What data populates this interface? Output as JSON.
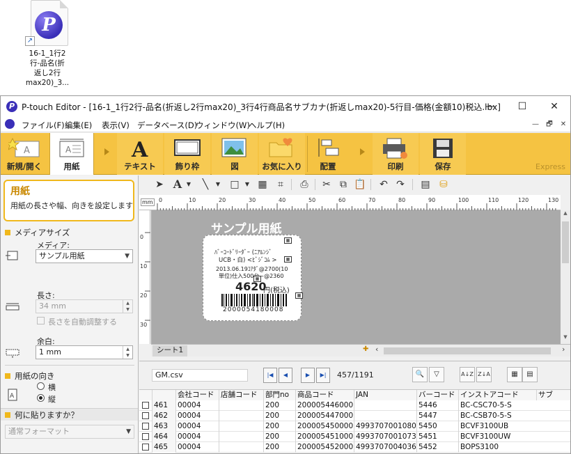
{
  "desktop_icon": {
    "label_lines": [
      "16-1_1行2",
      "行-品名(折",
      "返し2行",
      "max20)_3..."
    ]
  },
  "window": {
    "title": "P-touch Editor - [16-1_1行2行-品名(折返し2行max20)_3行4行商品名サブカナ(折返しmax20)-5行目-価格(金額10)税込.lbx]",
    "controls": {
      "minimize": "—",
      "maximize": "☐",
      "close": "✕"
    }
  },
  "menu": [
    "ファイル(F)",
    "編集(E)",
    "表示(V)",
    "データベース(D)",
    "ウィンドウ(W)",
    "ヘルプ(H)"
  ],
  "menu_right": [
    "—",
    "🗗",
    "✕"
  ],
  "ribbon": {
    "buttons": [
      {
        "id": "new-open",
        "label": "新規/開く"
      },
      {
        "id": "paper",
        "label": "用紙"
      },
      {
        "id": "text",
        "label": "テキスト"
      },
      {
        "id": "frame",
        "label": "飾り枠"
      },
      {
        "id": "image",
        "label": "図"
      },
      {
        "id": "favorite",
        "label": "お気に入り"
      },
      {
        "id": "layout",
        "label": "配置"
      },
      {
        "id": "print",
        "label": "印刷"
      },
      {
        "id": "save",
        "label": "保存"
      }
    ],
    "mode": "Express"
  },
  "panel": {
    "hint_title": "用紙",
    "hint_desc": "用紙の長さや幅、向きを設定します",
    "media_size_heading": "メディアサイズ",
    "media_label": "メディア:",
    "media_value": "サンプル用紙",
    "length_label": "長さ:",
    "length_value": "34 mm",
    "auto_length_label": "長さを自動調整する",
    "margin_label": "余白:",
    "margin_value": "1 mm",
    "orientation_heading": "用紙の向き",
    "orientation_options": [
      "横",
      "縦"
    ],
    "orientation_selected": "縦",
    "what_heading": "何に貼りますか？",
    "what_value": "通常フォーマット"
  },
  "ruler": {
    "unit": "mm",
    "ticks": [
      "0",
      "10",
      "20",
      "30",
      "40",
      "50",
      "60",
      "70",
      "80",
      "90",
      "100",
      "110",
      "120",
      "130"
    ],
    "vticks": [
      "0",
      "10",
      "20",
      "30"
    ]
  },
  "canvas": {
    "sample_title": "サンプル用紙",
    "sheet_tab": "シート1",
    "label_lines": [
      "ﾊﾞｰｺｰﾄﾞﾘｰﾀﾞｰ (ﾆｱﾙﾝｼﾞ",
      "UCB・白)  <ﾋﾞｼﾞｺﾑ >",
      "2013.06.19ｺｱﾀﾞ@2700(10",
      "単位)仕入500台~@2360",
      "4620",
      "円(税込)",
      "2000054180008"
    ]
  },
  "database": {
    "file": "GM.csv",
    "record_position": "457/1191",
    "columns": [
      "",
      "",
      "会社コード",
      "店舗コード",
      "部門no",
      "商品コード",
      "JAN",
      "バーコード",
      "インストアコード",
      "サブ"
    ],
    "rows": [
      [
        "461",
        "00004",
        "",
        "200",
        "200005446000",
        "",
        "5446",
        "BC-CSC70-5-S"
      ],
      [
        "462",
        "00004",
        "",
        "200",
        "200005447000",
        "",
        "5447",
        "BC-CSB70-5-S"
      ],
      [
        "463",
        "00004",
        "",
        "200",
        "200005450000",
        "4993707001080",
        "5450",
        "BCVF3100UB"
      ],
      [
        "464",
        "00004",
        "",
        "200",
        "200005451000",
        "4993707001073",
        "5451",
        "BCVF3100UW"
      ],
      [
        "465",
        "00004",
        "",
        "200",
        "200005452000",
        "4993707004036",
        "5452",
        "BOPS3100"
      ]
    ]
  },
  "colors": {
    "ribbon": "#f5c342",
    "accent": "#f0b81c",
    "canvas": "#aaaaaa"
  }
}
